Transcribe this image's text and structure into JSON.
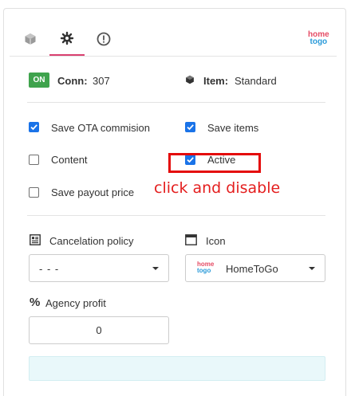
{
  "tabs": [
    {
      "name": "item-tab",
      "icon": "cube-icon"
    },
    {
      "name": "settings-tab",
      "icon": "gear-icon",
      "active": true
    },
    {
      "name": "info-tab",
      "icon": "exclamation-circle-icon"
    }
  ],
  "brand": {
    "home": "home",
    "togo": "togo"
  },
  "status": {
    "badge": "ON",
    "conn_label": "Conn:",
    "conn_value": "307"
  },
  "item": {
    "label": "Item:",
    "value": "Standard"
  },
  "options": {
    "save_ota": {
      "label": "Save OTA commision",
      "checked": true
    },
    "save_items": {
      "label": "Save items",
      "checked": true
    },
    "content": {
      "label": "Content",
      "checked": false
    },
    "active": {
      "label": "Active",
      "checked": true
    },
    "save_payout": {
      "label": "Save payout price",
      "checked": false
    }
  },
  "annotation": {
    "text": "click and disable",
    "color": "#e41e1e"
  },
  "cancelation": {
    "label": "Cancelation policy",
    "value": "- - -"
  },
  "icon_select": {
    "label": "Icon",
    "value": "HomeToGo"
  },
  "agency": {
    "label": "Agency profit",
    "value": "0"
  },
  "colors": {
    "accent": "#1a73e8",
    "badge": "#3fa34d",
    "tab_active": "#d94070"
  }
}
